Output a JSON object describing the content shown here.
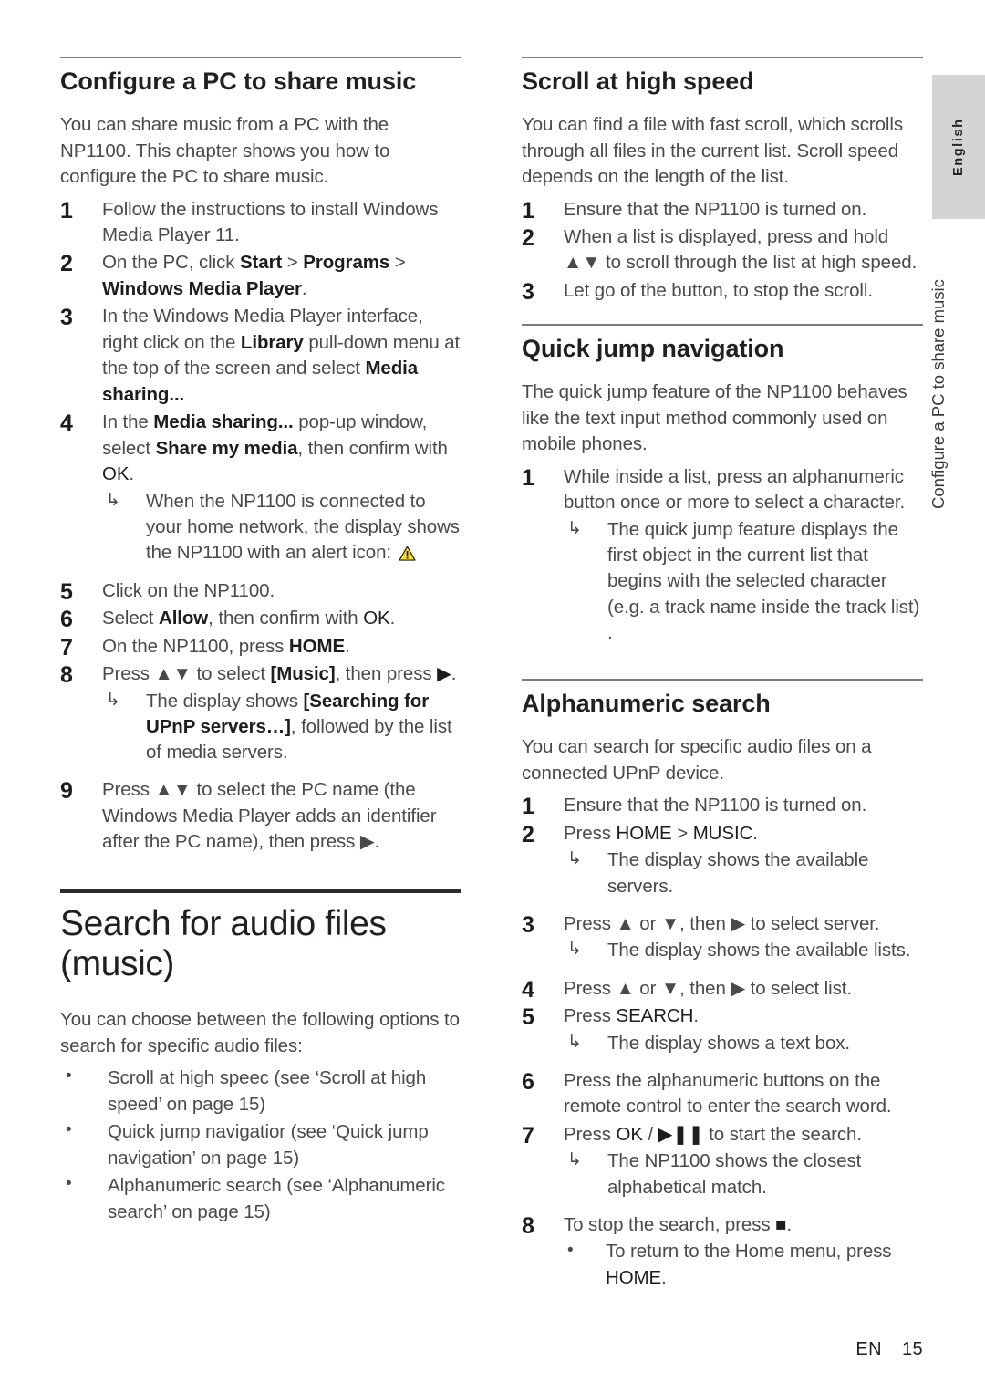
{
  "sidebar": {
    "language_tab": "English",
    "running_head": "Configure a PC to share music"
  },
  "footer": {
    "language_code": "EN",
    "page_number": "15"
  },
  "left_column": {
    "section1": {
      "heading": "Configure a PC to share music",
      "intro": "You can share music from a PC with the NP1100. This chapter shows you how to configure the PC to share music.",
      "steps": [
        {
          "num": "1",
          "text": "Follow the instructions to install Windows Media Player 11."
        },
        {
          "num": "2",
          "text_pre": "On the PC, click ",
          "bold1": "Start",
          "mid1": " > ",
          "bold2": "Programs",
          "mid2": " > ",
          "bold3": "Windows Media Player",
          "post": "."
        },
        {
          "num": "3",
          "text_pre": "In the Windows Media Player interface, right click on the  ",
          "bold1": "Library",
          "mid1": " pull-down menu at the top of the screen and select ",
          "bold2": "Media sharing...",
          "post": ""
        },
        {
          "num": "4",
          "text_pre": "In the ",
          "bold1": "Media sharing...",
          "mid1": " pop-up window, select ",
          "bold2": "Share my media",
          "mid2": ", then confirm with ",
          "bold3": "OK",
          "post": "."
        },
        {
          "num": "5",
          "text": "Click on the NP1100."
        },
        {
          "num": "6",
          "text_pre": "Select ",
          "bold1": "Allow",
          "mid1": ", then confirm with ",
          "bold2": "OK",
          "post": "."
        },
        {
          "num": "7",
          "text_pre": "On the NP1100, press ",
          "bold1": "HOME",
          "post": "."
        },
        {
          "num": "8",
          "text_pre": "Press ▲▼ to select ",
          "bold1": "[Music]",
          "mid1": ", then press ",
          "bold2": "▶",
          "post": "."
        },
        {
          "num": "9",
          "text": "Press ▲▼ to select the PC name (the Windows Media Player adds an identifier after the PC name), then press ▶."
        }
      ],
      "note_step4": {
        "arrow": "↳",
        "text_pre": "When the NP1100 is connected to your home network, the display shows the NP1100 with an alert icon:",
        "icon": "warning-triangle-icon"
      },
      "note_step8": {
        "arrow": "↳",
        "text_pre": "The display shows ",
        "bold1": "[Searching for UPnP servers…]",
        "post": ", followed by the list of media servers."
      }
    },
    "section2": {
      "heading": "Search for audio files (music)",
      "intro": "You can choose between the following options to search for specific audio files:",
      "bullets": [
        {
          "dot": "•",
          "text": "Scroll at high speec (see ‘Scroll at high speed’ on page 15)"
        },
        {
          "dot": "•",
          "text": "Quick jump navigatior (see ‘Quick jump navigation’ on page 15)"
        },
        {
          "dot": "•",
          "text": "Alphanumeric search (see ‘Alphanumeric search’ on page 15)"
        }
      ]
    }
  },
  "right_column": {
    "section1": {
      "heading": "Scroll at high speed",
      "intro": "You can find a file with fast scroll, which scrolls through all files in the current list. Scroll speed depends on the length of the list.",
      "steps": [
        {
          "num": "1",
          "text": "Ensure that the NP1100 is turned on."
        },
        {
          "num": "2",
          "text": "When a list is displayed, press and hold ▲▼ to scroll through the list at high speed."
        },
        {
          "num": "3",
          "text": "Let go of the button, to stop the scroll."
        }
      ]
    },
    "section2": {
      "heading": "Quick jump navigation",
      "intro": "The quick jump feature of the NP1100 behaves like the text input method commonly used on mobile phones.",
      "steps": [
        {
          "num": "1",
          "text": "While inside a list, press an alphanumeric button once or more to select a character."
        }
      ],
      "note": {
        "arrow": "↳",
        "text": "The quick jump feature displays the first object in the current list that begins with the selected character (e.g. a track name inside the track list) ."
      }
    },
    "section3": {
      "heading": "Alphanumeric search",
      "intro": "You can search for specific audio files on a connected UPnP device.",
      "steps": [
        {
          "num": "1",
          "text": "Ensure that the NP1100 is turned on."
        },
        {
          "num": "2",
          "text_pre": "Press ",
          "bold1": "HOME",
          "mid1": " > ",
          "bold2": "MUSIC",
          "post": "."
        },
        {
          "num": "3",
          "text": "Press ▲ or ▼, then ▶ to select server."
        },
        {
          "num": "4",
          "text": "Press ▲ or ▼, then ▶ to select list."
        },
        {
          "num": "5",
          "text_pre": "Press ",
          "bold1": "SEARCH",
          "post": "."
        },
        {
          "num": "6",
          "text": "Press the alphanumeric buttons on the remote control to enter the search word."
        },
        {
          "num": "7",
          "text_pre": "Press ",
          "bold1": "OK",
          "mid1": " / ",
          "bold2": "▶❚❚",
          "post": " to start the search."
        },
        {
          "num": "8",
          "text_pre": "To stop the search, press ",
          "bold1": "■",
          "post": "."
        }
      ],
      "note_step2": {
        "arrow": "↳",
        "text": "The display shows the available servers."
      },
      "note_step3": {
        "arrow": "↳",
        "text": "The display shows the available lists."
      },
      "note_step5": {
        "arrow": "↳",
        "text": "The display shows a text box."
      },
      "note_step7": {
        "arrow": "↳",
        "text": "The NP1100 shows the closest alphabetical match."
      },
      "bullet_step8": {
        "dot": "•",
        "text_pre": "To return to the Home menu, press ",
        "bold1": "HOME",
        "post": "."
      }
    }
  },
  "colors": {
    "sidebar_tab_bg": "#d3d4d6",
    "heading": "#231f20",
    "body_text": "#4a4a4d",
    "rule_thin": "#7c7c80",
    "rule_thick": "#2c2c2e",
    "warning_yellow": "#f7e024"
  }
}
